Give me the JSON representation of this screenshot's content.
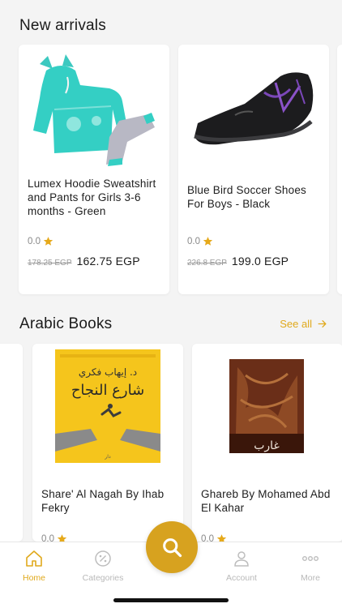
{
  "sections": {
    "new_arrivals": {
      "title": "New arrivals",
      "products": [
        {
          "name": "Lumex Hoodie Sweatshirt and  Pants for Girls 3-6 months - Green",
          "rating": "0.0",
          "old_price": "178.25 EGP",
          "price": "162.75 EGP"
        },
        {
          "name": "Blue Bird Soccer Shoes  For Boys - Black",
          "rating": "0.0",
          "old_price": "226.8 EGP",
          "price": "199.0 EGP"
        }
      ]
    },
    "arabic_books": {
      "title": "Arabic Books",
      "see_all": "See all",
      "products": [
        {
          "name": "Share' Al Nagah By Ihab Fekry",
          "rating": "0.0",
          "cover_author": "د. إيهاب فكري",
          "cover_title": "شارع النجاح"
        },
        {
          "name": "Ghareb By Mohamed Abd El Kahar",
          "rating": "0.0",
          "cover_title": "غارب"
        }
      ]
    }
  },
  "tabbar": {
    "items": [
      {
        "label": "Home",
        "icon": "home-icon",
        "active": true
      },
      {
        "label": "Categories",
        "icon": "percent-icon",
        "active": false
      },
      {
        "label": "Account",
        "icon": "user-icon",
        "active": false
      },
      {
        "label": "More",
        "icon": "more-icon",
        "active": false
      }
    ],
    "center_button_icon": "search-icon"
  },
  "colors": {
    "accent": "#e0a91c",
    "fab": "#d7a21f",
    "background": "#f4f4f4"
  }
}
